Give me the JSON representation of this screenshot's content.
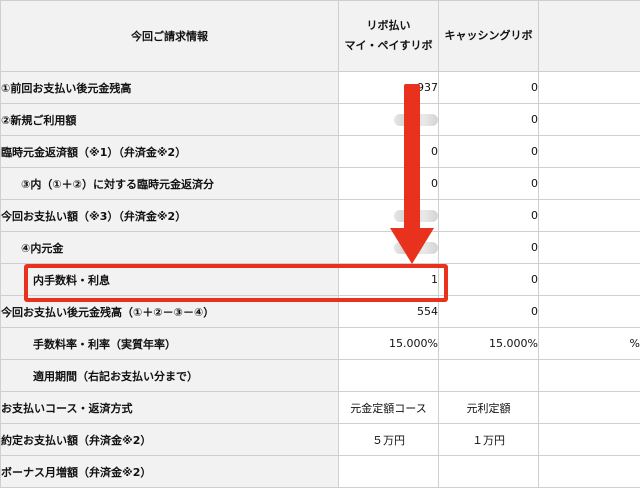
{
  "header": {
    "label_col": "今回ご請求情報",
    "revo_col_line1": "リボ払い",
    "revo_col_line2": "マイ・ペイすリボ",
    "cash_col": "キャッシングリボ",
    "extra_col": ""
  },
  "rows": [
    {
      "label": "①前回お支払い後元金残高",
      "revo": "937",
      "cash": "0",
      "extra": ""
    },
    {
      "label": "②新規ご利用額",
      "revo": "",
      "revo_redacted": true,
      "cash": "0",
      "extra": ""
    },
    {
      "label": "臨時元金返済額（※1）（弁済金※2）",
      "revo": "0",
      "cash": "0",
      "extra": ""
    },
    {
      "label": "③内（①＋②）に対する臨時元金返済分",
      "revo": "0",
      "cash": "0",
      "extra": ""
    },
    {
      "label": "今回お支払い額（※3）（弁済金※2）",
      "revo": "",
      "revo_redacted": true,
      "cash": "0",
      "extra": ""
    },
    {
      "label": "④内元金",
      "revo": "",
      "revo_redacted": true,
      "cash": "0",
      "extra": ""
    },
    {
      "label": "内手数料・利息",
      "revo": "1",
      "cash": "0",
      "extra": ""
    },
    {
      "label": "今回お支払い後元金残高（①＋②－③－④）",
      "revo": "554",
      "cash": "0",
      "extra": ""
    },
    {
      "label": "手数料率・利率（実質年率）",
      "revo": "15.000%",
      "cash": "15.000%",
      "extra": "%"
    },
    {
      "label": "適用期間（右記お支払い分まで）",
      "revo": "",
      "cash": "",
      "extra": ""
    },
    {
      "label": "お支払いコース・返済方式",
      "revo": "元金定額コース",
      "cash": "元利定額",
      "extra": ""
    },
    {
      "label": "約定お支払い額（弁済金※2）",
      "revo": "５万円",
      "cash": "１万円",
      "extra": ""
    },
    {
      "label": "ボーナス月増額（弁済金※2）",
      "revo": "",
      "cash": "",
      "extra": ""
    }
  ],
  "annotation": {
    "highlight_color": "#e8321e",
    "highlighted_row": "内手数料・利息"
  }
}
